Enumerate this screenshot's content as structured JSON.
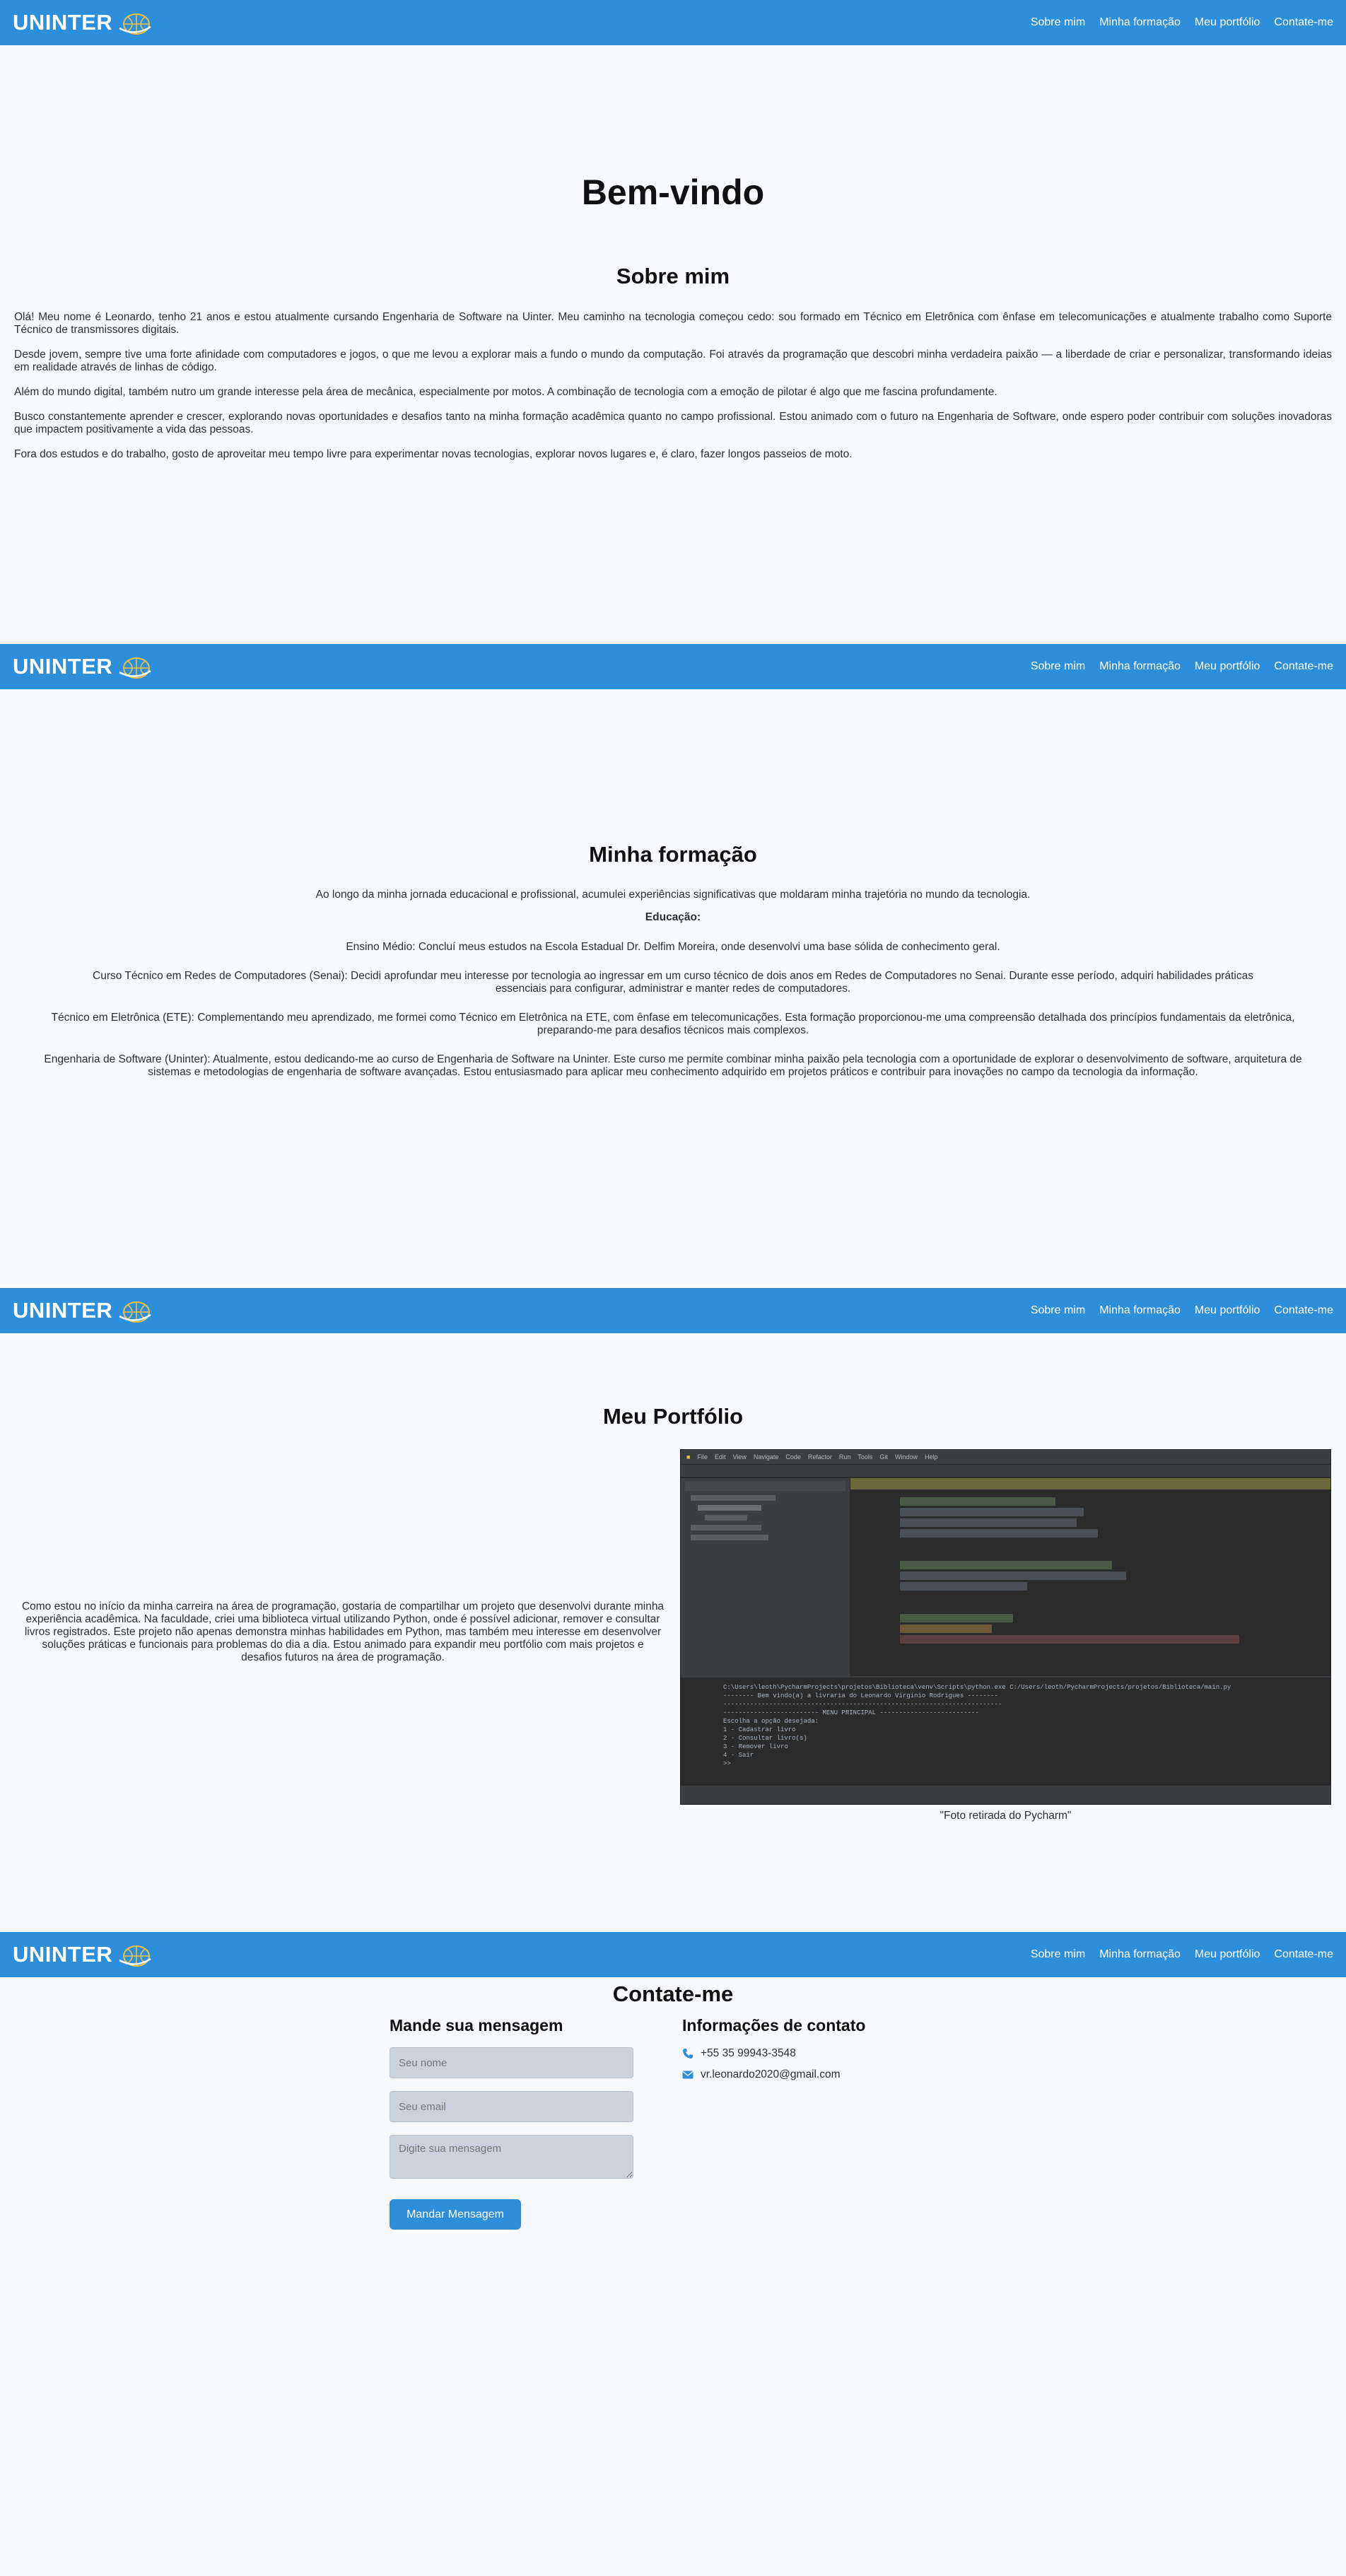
{
  "nav": {
    "logo_text": "UNINTER",
    "links": [
      "Sobre mim",
      "Minha formação",
      "Meu portfólio",
      "Contate-me"
    ]
  },
  "about": {
    "welcome": "Bem-vindo",
    "title": "Sobre mim",
    "paragraphs": [
      "Olá! Meu nome é Leonardo, tenho 21 anos e estou atualmente cursando Engenharia de Software na Uinter. Meu caminho na tecnologia começou cedo: sou formado em Técnico em Eletrônica com ênfase em telecomunicações e atualmente trabalho como Suporte Técnico de transmissores digitais.",
      "Desde jovem, sempre tive uma forte afinidade com computadores e jogos, o que me levou a explorar mais a fundo o mundo da computação. Foi através da programação que descobri minha verdadeira paixão — a liberdade de criar e personalizar, transformando ideias em realidade através de linhas de código.",
      "Além do mundo digital, também nutro um grande interesse pela área de mecânica, especialmente por motos. A combinação de tecnologia com a emoção de pilotar é algo que me fascina profundamente.",
      "Busco constantemente aprender e crescer, explorando novas oportunidades e desafios tanto na minha formação acadêmica quanto no campo profissional. Estou animado com o futuro na Engenharia de Software, onde espero poder contribuir com soluções inovadoras que impactem positivamente a vida das pessoas.",
      "Fora dos estudos e do trabalho, gosto de aproveitar meu tempo livre para experimentar novas tecnologias, explorar novos lugares e, é claro, fazer longos passeios de moto."
    ]
  },
  "education": {
    "title": "Minha formação",
    "intro": "Ao longo da minha jornada educacional e profissional, acumulei experiências significativas que moldaram minha trajetória no mundo da tecnologia.",
    "subtitle": "Educação:",
    "items": [
      "Ensino Médio: Concluí meus estudos na Escola Estadual Dr. Delfim Moreira, onde desenvolvi uma base sólida de conhecimento geral.",
      "Curso Técnico em Redes de Computadores (Senai): Decidi aprofundar meu interesse por tecnologia ao ingressar em um curso técnico de dois anos em Redes de Computadores no Senai. Durante esse período, adquiri habilidades práticas essenciais para configurar, administrar e manter redes de computadores.",
      "Técnico em Eletrônica (ETE): Complementando meu aprendizado, me formei como Técnico em Eletrônica na ETE, com ênfase em telecomunicações. Esta formação proporcionou-me uma compreensão detalhada dos princípios fundamentais da eletrônica, preparando-me para desafios técnicos mais complexos.",
      "Engenharia de Software (Uninter): Atualmente, estou dedicando-me ao curso de Engenharia de Software na Uninter. Este curso me permite combinar minha paixão pela tecnologia com a oportunidade de explorar o desenvolvimento de software, arquitetura de sistemas e metodologias de engenharia de software avançadas. Estou entusiasmado para aplicar meu conhecimento adquirido em projetos práticos e contribuir para inovações no campo da tecnologia da informação."
    ]
  },
  "portfolio": {
    "title": "Meu Portfólio",
    "description": "Como estou no início da minha carreira na área de programação, gostaria de compartilhar um projeto que desenvolvi durante minha experiência acadêmica. Na faculdade, criei uma biblioteca virtual utilizando Python, onde é possível adicionar, remover e consultar livros registrados. Este projeto não apenas demonstra minhas habilidades em Python, mas também meu interesse em desenvolver soluções práticas e funcionais para problemas do dia a dia. Estou animado para expandir meu portfólio com mais projetos e desafios futuros na área de programação.",
    "caption": "\"Foto retirada do Pycharm\"",
    "console_lines": [
      "C:\\Users\\leoth\\PycharmProjects\\projetos\\Biblioteca\\venv\\Scripts\\python.exe C:/Users/leoth/PycharmProjects/projetos/Biblioteca/main.py",
      "-------- Bem vindo(a) a livraria do Leonardo Virginio Rodrigues --------",
      "-------------------------------------------------------------------------",
      "------------------------- MENU PRINCIPAL --------------------------",
      "Escolha a opção desejada:",
      "1 - Cadastrar livro",
      "2 - Consultar livro(s)",
      "3 - Remover livro",
      "4 - Sair",
      ">>"
    ]
  },
  "contact": {
    "title": "Contate-me",
    "form_title": "Mande sua mensagem",
    "name_placeholder": "Seu nome",
    "email_placeholder": "Seu email",
    "message_placeholder": "Digite sua mensagem",
    "send_label": "Mandar Mensagem",
    "info_title": "Informações de contato",
    "phone": "+55 35 99943-3548",
    "email": "vr.leonardo2020@gmail.com"
  },
  "colors": {
    "nav": "#2d8fdc",
    "background": "#f7f9fc",
    "button": "#2d8fdc"
  }
}
